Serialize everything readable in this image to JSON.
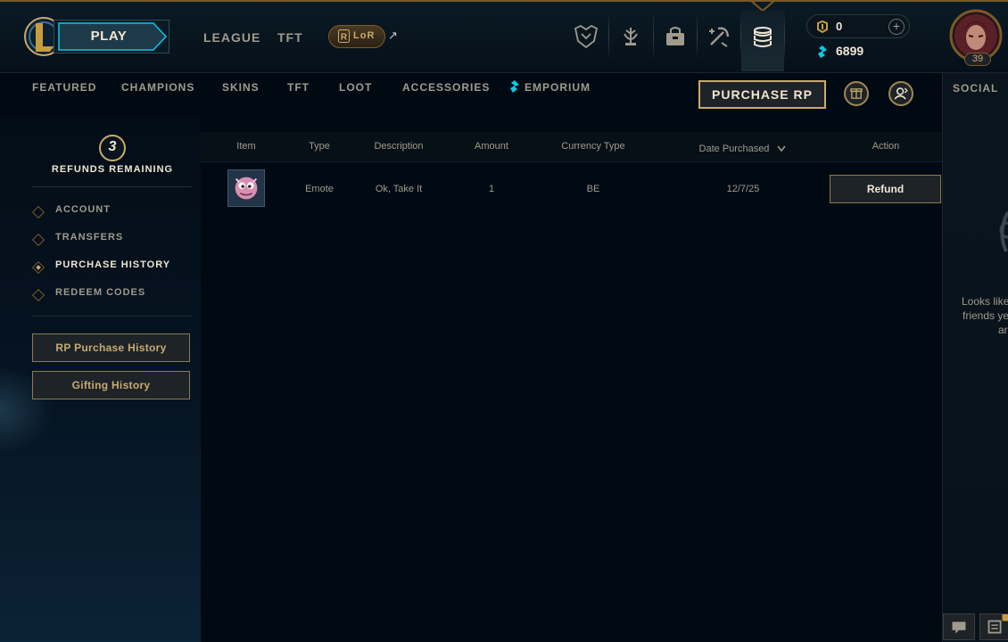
{
  "topbar": {
    "play_label": "PLAY",
    "links": [
      "LEAGUE",
      "TFT"
    ],
    "lor_label": "LoR",
    "external_arrow": "↗",
    "nav_icons": [
      "worlds-icon",
      "tft-tactician-icon",
      "collection-icon",
      "loot-icon",
      "store-icon"
    ],
    "rp_value": "0",
    "be_value": "6899",
    "plus_label": "+",
    "level": "39"
  },
  "subnav": {
    "items": [
      "FEATURED",
      "CHAMPIONS",
      "SKINS",
      "TFT",
      "LOOT",
      "ACCESSORIES"
    ],
    "emporium": "EMPORIUM",
    "purchase_rp": "PURCHASE RP"
  },
  "sidebar": {
    "refunds_count": "3",
    "refunds_label": "REFUNDS REMAINING",
    "items": [
      {
        "label": "ACCOUNT",
        "active": false
      },
      {
        "label": "TRANSFERS",
        "active": false
      },
      {
        "label": "PURCHASE HISTORY",
        "active": true
      },
      {
        "label": "REDEEM CODES",
        "active": false
      }
    ],
    "rp_history_button": "RP Purchase History",
    "gifting_history_button": "Gifting History"
  },
  "table": {
    "headers": [
      "Item",
      "Type",
      "Description",
      "Amount",
      "Currency Type",
      "Date Purchased",
      "Action"
    ],
    "rows": [
      {
        "type": "Emote",
        "description": "Ok, Take It",
        "amount": "1",
        "currency": "BE",
        "date": "12/7/25",
        "action": "Refund"
      }
    ]
  },
  "social": {
    "title": "SOCIAL",
    "message": [
      "Looks like",
      "friends ye",
      "ar"
    ]
  },
  "colors": {
    "gold": "#c8aa6e",
    "gold_dark": "#785a28",
    "text": "#a09b8c",
    "text_bright": "#f0e6d2",
    "blue_essence": "#0acbe6",
    "background": "#010a13"
  }
}
